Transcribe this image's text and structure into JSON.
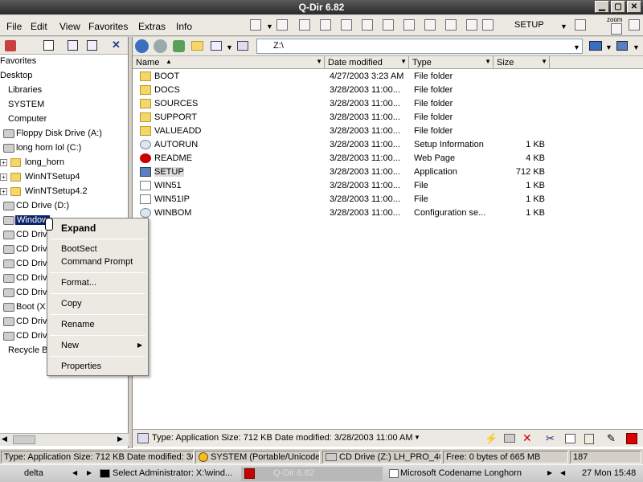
{
  "window": {
    "title": "Q-Dir 6.82"
  },
  "menu": [
    "File",
    "Edit",
    "View",
    "Favorites",
    "Extras",
    "Info"
  ],
  "toolbar": {
    "setup_label": "SETUP",
    "zoom_label": "zoom"
  },
  "tree": {
    "items": [
      {
        "label": "Favorites"
      },
      {
        "label": "Desktop"
      },
      {
        "label": "Libraries"
      },
      {
        "label": "SYSTEM"
      },
      {
        "label": "Computer"
      },
      {
        "label": "Floppy Disk Drive (A:)"
      },
      {
        "label": "long horn lol (C:)"
      },
      {
        "label": "long_horn"
      },
      {
        "label": "WinNTSetup4"
      },
      {
        "label": "WinNTSetup4.2"
      },
      {
        "label": "CD Drive (D:)"
      },
      {
        "label": "Window"
      },
      {
        "label": "CD Driv"
      },
      {
        "label": "CD Driv"
      },
      {
        "label": "CD Driv"
      },
      {
        "label": "CD Driv"
      },
      {
        "label": "CD Driv"
      },
      {
        "label": "Boot (X"
      },
      {
        "label": "CD Driv"
      },
      {
        "label": "CD Driv"
      },
      {
        "label": "Recycle B"
      }
    ]
  },
  "address": {
    "value": "Z:\\"
  },
  "columns": [
    "Name",
    "Date modified",
    "Type",
    "Size"
  ],
  "files": [
    {
      "name": "BOOT",
      "date": "4/27/2003 3:23 AM",
      "type": "File folder",
      "size": "",
      "icon": "folder"
    },
    {
      "name": "DOCS",
      "date": "3/28/2003 11:00...",
      "type": "File folder",
      "size": "",
      "icon": "folder"
    },
    {
      "name": "SOURCES",
      "date": "3/28/2003 11:00...",
      "type": "File folder",
      "size": "",
      "icon": "folder"
    },
    {
      "name": "SUPPORT",
      "date": "3/28/2003 11:00...",
      "type": "File folder",
      "size": "",
      "icon": "folder"
    },
    {
      "name": "VALUEADD",
      "date": "3/28/2003 11:00...",
      "type": "File folder",
      "size": "",
      "icon": "folder"
    },
    {
      "name": "AUTORUN",
      "date": "3/28/2003 11:00...",
      "type": "Setup Information",
      "size": "1 KB",
      "icon": "gear"
    },
    {
      "name": "README",
      "date": "3/28/2003 11:00...",
      "type": "Web Page",
      "size": "4 KB",
      "icon": "html"
    },
    {
      "name": "SETUP",
      "date": "3/28/2003 11:00...",
      "type": "Application",
      "size": "712 KB",
      "icon": "app"
    },
    {
      "name": "WIN51",
      "date": "3/28/2003 11:00...",
      "type": "File",
      "size": "1 KB",
      "icon": "file"
    },
    {
      "name": "WIN51IP",
      "date": "3/28/2003 11:00...",
      "type": "File",
      "size": "1 KB",
      "icon": "file"
    },
    {
      "name": "WINBOM",
      "date": "3/28/2003 11:00...",
      "type": "Configuration se...",
      "size": "1 KB",
      "icon": "gear"
    }
  ],
  "context_menu": {
    "items": [
      "Expand",
      "BootSect",
      "Command Prompt",
      "Format...",
      "Copy",
      "Rename",
      "New",
      "Properties"
    ]
  },
  "pane_status": {
    "text": "Type: Application Size: 712 KB Date modified: 3/28/2003 11:00 AM"
  },
  "statusbar": {
    "left": "Type: Application Size: 712 KB Date modified: 3/2",
    "system": "SYSTEM (Portable/Unicode)",
    "drive": "CD Drive (Z:) LH_PRO_40",
    "free": "Free: 0 bytes of 665 MB",
    "count": "187"
  },
  "taskbar": {
    "start_label": "delta",
    "items": [
      "Select Administrator: X:\\wind...",
      "Q-Dir 6.82",
      "Microsoft Codename Longhorn"
    ],
    "clock": "27 Mon 15:48"
  },
  "colors": {
    "selection": "#0a246a",
    "title_bg": "#3a3a3a"
  }
}
